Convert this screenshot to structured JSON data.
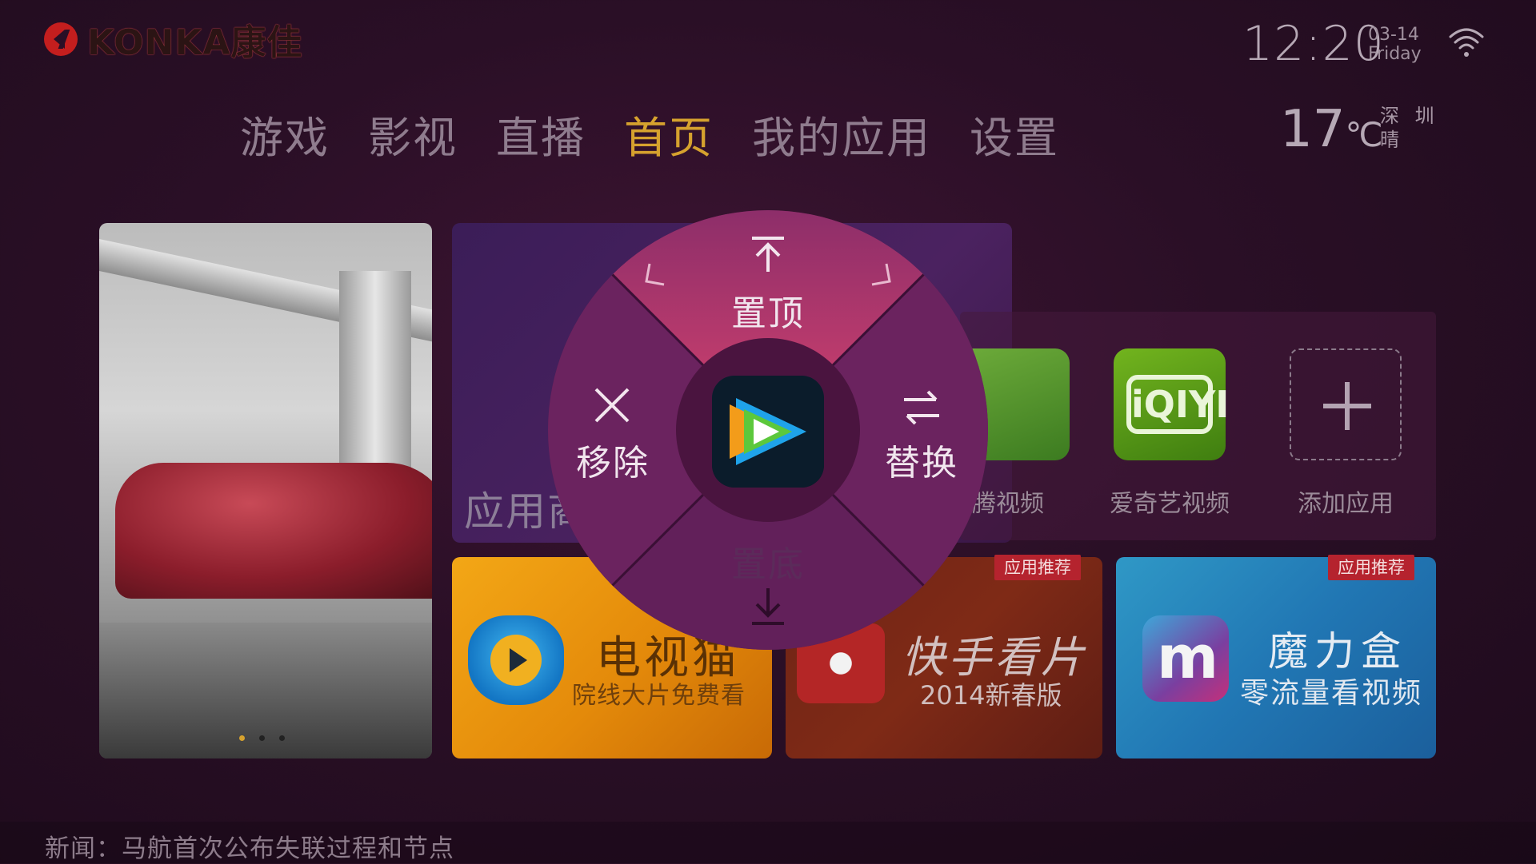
{
  "brand": {
    "logo_text": "KONKA康佳"
  },
  "status": {
    "time": "12:20",
    "date": "03-14",
    "weekday": "Friday",
    "temperature": "17",
    "temp_unit": "℃",
    "city": "深 圳",
    "weather": "晴"
  },
  "nav": {
    "items": [
      {
        "label": "游戏"
      },
      {
        "label": "影视"
      },
      {
        "label": "直播"
      },
      {
        "label": "首页",
        "active": true
      },
      {
        "label": "我的应用"
      },
      {
        "label": "设置"
      }
    ]
  },
  "tiles": {
    "app_store_label": "应用商店",
    "my_apps": [
      {
        "label": "腾讯视频",
        "visible_label": "腾视频"
      },
      {
        "label": "爱奇艺视频"
      },
      {
        "label": "添加应用"
      }
    ],
    "tvcat": {
      "title": "电视猫",
      "subtitle": "院线大片免费看"
    },
    "kuaishou": {
      "title": "快手看片",
      "subtitle": "2014新春版",
      "badge": "应用推荐"
    },
    "molihe": {
      "title": "魔力盒",
      "subtitle": "零流量看视频",
      "badge": "应用推荐",
      "icon_letter": "m"
    }
  },
  "context_menu": {
    "top": "置顶",
    "left": "移除",
    "right": "替换",
    "bottom": "置底"
  },
  "iqiyi_word": "iQIYI",
  "carousel": {
    "count": 3,
    "active_index": 0
  },
  "ticker": {
    "text": "新闻：马航首次公布失联过程和节点"
  },
  "colors": {
    "accent": "#d6a22e",
    "wheel_top": "#c23b6e",
    "wheel_body": "#6a2560",
    "badge": "#b5232e"
  }
}
